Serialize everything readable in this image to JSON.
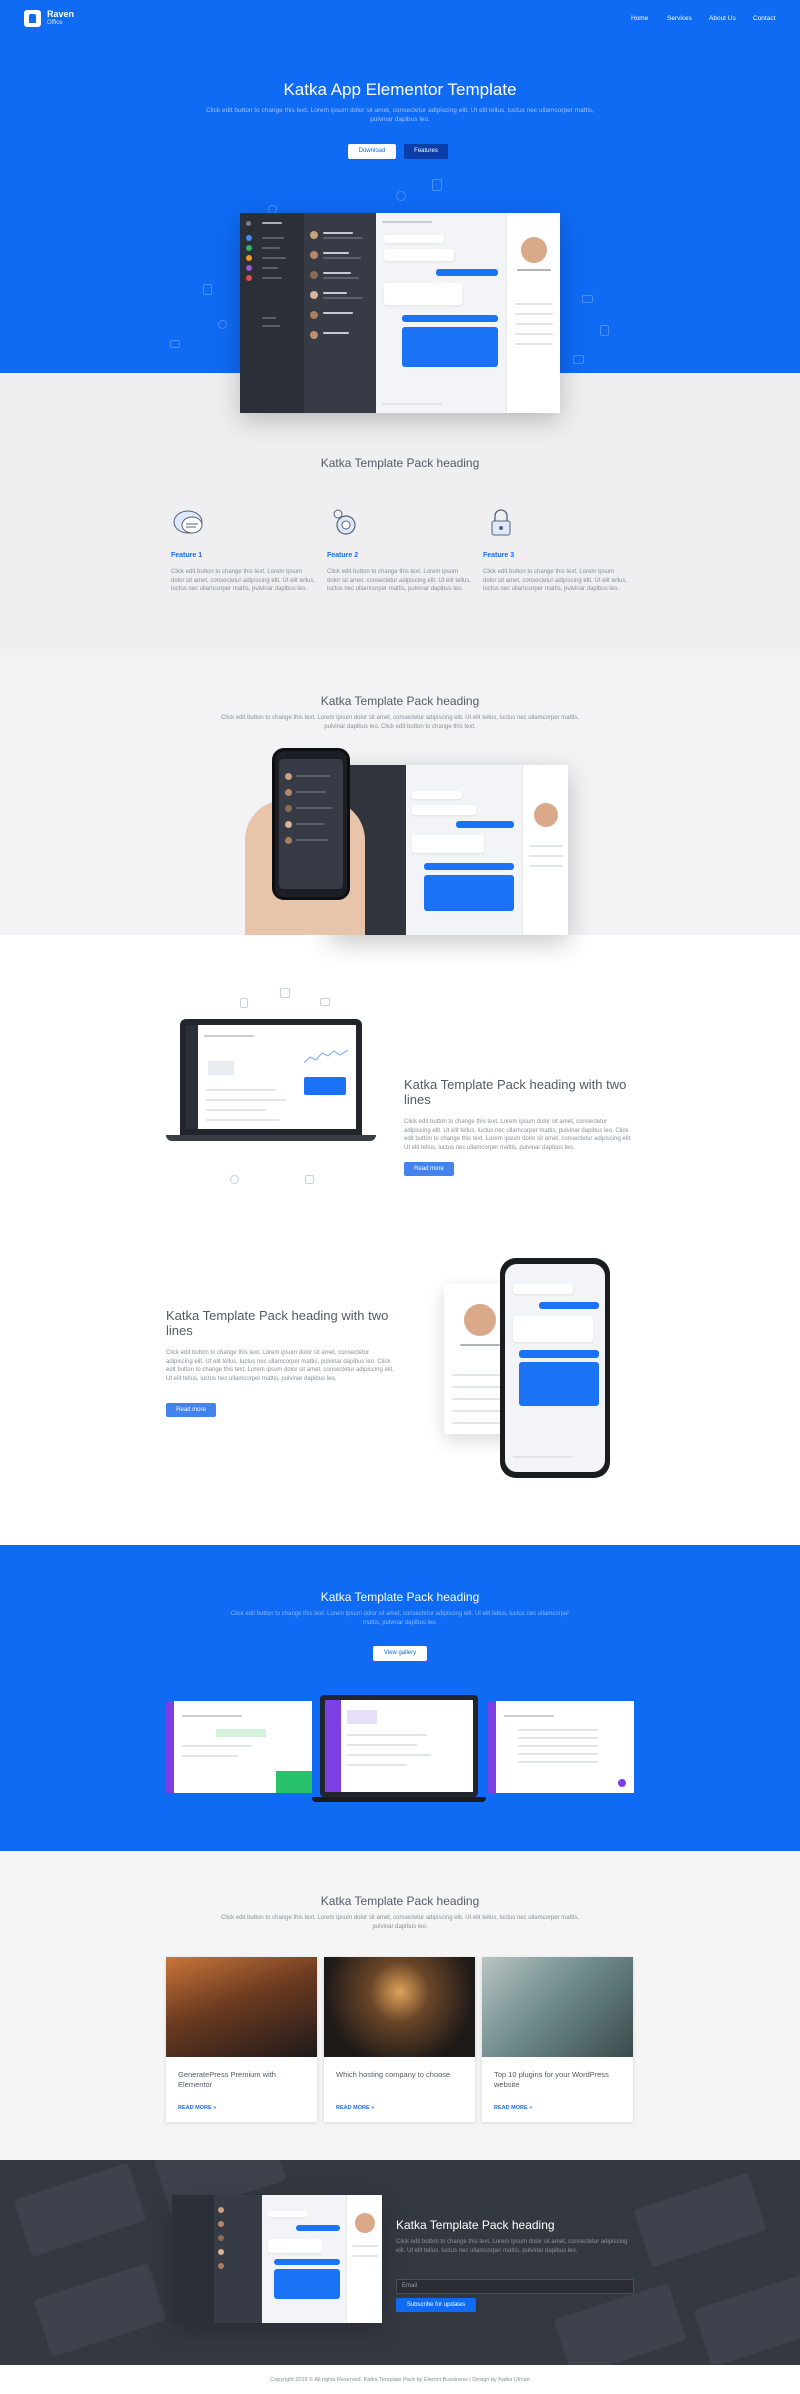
{
  "brand": {
    "name": "Raven",
    "tagline": "Office"
  },
  "nav": {
    "items": [
      "Home",
      "Services",
      "About Us",
      "Contact"
    ]
  },
  "hero": {
    "title": "Katka App Elementor Template",
    "subtitle": "Click edit button to change this text. Lorem ipsum dolor sit amet, consectetur adipiscing elit. Ut elit tellus, luctus nec ullamcorper mattis, pulvinar dapibus leo.",
    "download_label": "Download",
    "features_label": "Features"
  },
  "features_section": {
    "heading": "Katka Template Pack heading",
    "items": [
      {
        "icon": "chat-bubbles-icon",
        "title": "Feature 1",
        "text": "Click edit button to change this text. Lorem ipsum dolor sit amet, consectetur adipiscing elit. Ut elit tellus, luctus nec ullamcorper mattis, pulvinar dapibus leo."
      },
      {
        "icon": "gear-icon",
        "title": "Feature 2",
        "text": "Click edit button to change this text. Lorem ipsum dolor sit amet, consectetur adipiscing elit. Ut elit tellus, luctus nec ullamcorper mattis, pulvinar dapibus leo."
      },
      {
        "icon": "lock-icon",
        "title": "Feature 3",
        "text": "Click edit button to change this text. Lorem ipsum dolor sit amet, consectetur adipiscing elit. Ut elit tellus, luctus nec ullamcorper mattis, pulvinar dapibus leo."
      }
    ]
  },
  "devices_section": {
    "heading": "Katka Template Pack heading",
    "text": "Click edit button to change this text. Lorem ipsum dolor sit amet, consectetur adipiscing elit. Ut elit tellus, luctus nec ullamcorper mattis, pulvinar dapibus leo. Click edit button to change this text."
  },
  "laptop_section": {
    "heading": "Katka Template Pack heading with two lines",
    "text": "Click edit button to change this text. Lorem ipsum dolor sit amet, consectetur adipiscing elit. Ut elit tellus, luctus nec ullamcorper mattis, pulvinar dapibus leo. Click edit button to change this text. Lorem ipsum dolor sit amet, consectetur adipiscing elit. Ut elit tellus, luctus nec ullamcorper mattis, pulvinar dapibus leo.",
    "button_label": "Read more"
  },
  "phone_section": {
    "heading": "Katka Template Pack heading with two lines",
    "text": "Click edit button to change this text. Lorem ipsum dolor sit amet, consectetur adipiscing elit. Ut elit tellus, luctus nec ullamcorper mattis, pulvinar dapibus leo. Click edit button to change this text. Lorem ipsum dolor sit amet, consectetur adipiscing elit. Ut elit tellus, luctus nec ullamcorper mattis, pulvinar dapibus leo.",
    "button_label": "Read more"
  },
  "gallery_section": {
    "heading": "Katka Template Pack heading",
    "text": "Click edit button to change this text. Lorem ipsum dolor sit amet, consectetur adipiscing elit. Ut elit tellus, luctus nec ullamcorper mattis, pulvinar dapibus leo.",
    "button_label": "View gallery"
  },
  "blog_section": {
    "heading": "Katka Template Pack heading",
    "text": "Click edit button to change this text. Lorem ipsum dolor sit amet, consectetur adipiscing elit. Ut elit tellus, luctus nec ullamcorper mattis, pulvinar dapibus leo.",
    "posts": [
      {
        "title": "GeneratePress Premium with Elementor",
        "more": "READ MORE »"
      },
      {
        "title": "Which hosting company to choose",
        "more": "READ MORE »"
      },
      {
        "title": "Top 10 plugins for your WordPress website",
        "more": "READ MORE »"
      }
    ]
  },
  "subscribe_section": {
    "heading": "Katka Template Pack heading",
    "text": "Click edit button to change this text. Lorem ipsum dolor sit amet, consectetur adipiscing elit. Ut elit tellus, luctus nec ullamcorper mattis, pulvinar dapibus leo.",
    "email_placeholder": "Email",
    "button_label": "Subscribe for updates"
  },
  "footer": {
    "copyright": "Copyright 2019 © All rights Reserved. Katka Template Pack by Elemnt Bussiness | Design by Katka Ulman"
  },
  "colors": {
    "primary": "#0f6af4",
    "dark": "#343841",
    "light": "#efeff1"
  }
}
